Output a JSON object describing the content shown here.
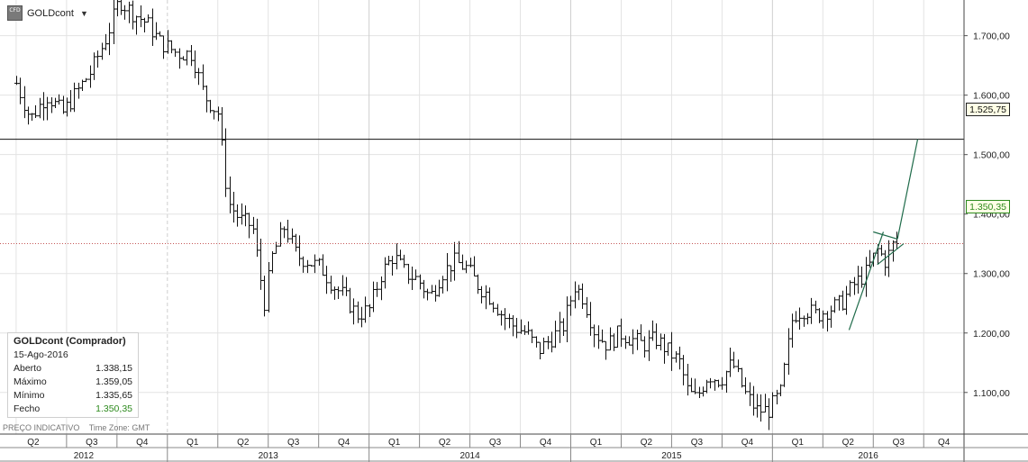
{
  "symbol": {
    "name": "GOLDcont",
    "icon_text": "CFD"
  },
  "info_box": {
    "title": "GOLDcont (Comprador)",
    "date": "15-Ago-2016",
    "open_label": "Aberto",
    "open_value": "1.338,15",
    "high_label": "Máximo",
    "high_value": "1.359,05",
    "low_label": "Mínimo",
    "low_value": "1.335,65",
    "close_label": "Fecho",
    "close_value": "1.350,35"
  },
  "footer": {
    "indicative": "PREÇO INDICATIVO",
    "timezone": "Time Zone: GMT"
  },
  "price_tags": {
    "resistance": "1.525,75",
    "current": "1.350,35"
  },
  "colors": {
    "up_close": "#2e8b1e",
    "bars": "#111111",
    "trendline": "#1f6b4a",
    "current_line": "#b22222"
  },
  "chart_data": {
    "type": "ohlc",
    "instrument": "GOLDcont",
    "ylim": [
      1030,
      1760
    ],
    "y_ticks": [
      1100,
      1200,
      1300,
      1400,
      1500,
      1600,
      1700
    ],
    "y_tick_labels": [
      "1.100,00",
      "1.200,00",
      "1.300,00",
      "1.400,00",
      "1.500,00",
      "1.600,00",
      "1.700,00"
    ],
    "quarters": [
      "Q2",
      "Q3",
      "Q4",
      "Q1",
      "Q2",
      "Q3",
      "Q4",
      "Q1",
      "Q2",
      "Q3",
      "Q4",
      "Q1",
      "Q2",
      "Q3",
      "Q4",
      "Q1",
      "Q2",
      "Q3",
      "Q4"
    ],
    "years": [
      "2012",
      "2013",
      "2014",
      "2015",
      "2016"
    ],
    "current_price": 1350.35,
    "resistance_level": 1525.75,
    "price_path": [
      [
        2012.25,
        1620
      ],
      [
        2012.32,
        1560
      ],
      [
        2012.4,
        1600
      ],
      [
        2012.48,
        1570
      ],
      [
        2012.56,
        1610
      ],
      [
        2012.62,
        1640
      ],
      [
        2012.7,
        1700
      ],
      [
        2012.76,
        1760
      ],
      [
        2012.82,
        1740
      ],
      [
        2012.9,
        1720
      ],
      [
        2012.96,
        1690
      ],
      [
        2013.05,
        1670
      ],
      [
        2013.12,
        1670
      ],
      [
        2013.18,
        1600
      ],
      [
        2013.25,
        1570
      ],
      [
        2013.3,
        1420
      ],
      [
        2013.36,
        1390
      ],
      [
        2013.42,
        1380
      ],
      [
        2013.48,
        1250
      ],
      [
        2013.52,
        1330
      ],
      [
        2013.58,
        1380
      ],
      [
        2013.64,
        1330
      ],
      [
        2013.7,
        1320
      ],
      [
        2013.76,
        1310
      ],
      [
        2013.82,
        1280
      ],
      [
        2013.88,
        1260
      ],
      [
        2013.94,
        1230
      ],
      [
        2014.0,
        1240
      ],
      [
        2014.06,
        1300
      ],
      [
        2014.12,
        1330
      ],
      [
        2014.18,
        1300
      ],
      [
        2014.24,
        1290
      ],
      [
        2014.3,
        1260
      ],
      [
        2014.36,
        1300
      ],
      [
        2014.42,
        1320
      ],
      [
        2014.48,
        1310
      ],
      [
        2014.54,
        1280
      ],
      [
        2014.6,
        1260
      ],
      [
        2014.66,
        1230
      ],
      [
        2014.72,
        1210
      ],
      [
        2014.78,
        1200
      ],
      [
        2014.84,
        1170
      ],
      [
        2014.9,
        1190
      ],
      [
        2014.96,
        1210
      ],
      [
        2015.02,
        1280
      ],
      [
        2015.06,
        1260
      ],
      [
        2015.12,
        1200
      ],
      [
        2015.18,
        1180
      ],
      [
        2015.24,
        1200
      ],
      [
        2015.3,
        1190
      ],
      [
        2015.36,
        1180
      ],
      [
        2015.42,
        1190
      ],
      [
        2015.48,
        1170
      ],
      [
        2015.54,
        1150
      ],
      [
        2015.58,
        1100
      ],
      [
        2015.62,
        1090
      ],
      [
        2015.68,
        1130
      ],
      [
        2015.74,
        1120
      ],
      [
        2015.8,
        1150
      ],
      [
        2015.86,
        1100
      ],
      [
        2015.92,
        1070
      ],
      [
        2015.98,
        1070
      ],
      [
        2016.04,
        1100
      ],
      [
        2016.1,
        1230
      ],
      [
        2016.16,
        1240
      ],
      [
        2016.22,
        1230
      ],
      [
        2016.28,
        1240
      ],
      [
        2016.34,
        1250
      ],
      [
        2016.4,
        1280
      ],
      [
        2016.46,
        1300
      ],
      [
        2016.52,
        1340
      ],
      [
        2016.56,
        1320
      ],
      [
        2016.6,
        1350
      ],
      [
        2016.62,
        1350.35
      ]
    ],
    "trendlines": [
      {
        "from": [
          2016.38,
          1205
        ],
        "to": [
          2016.55,
          1370
        ]
      },
      {
        "from": [
          2016.5,
          1370
        ],
        "to": [
          2016.62,
          1358
        ]
      },
      {
        "from": [
          2016.52,
          1315
        ],
        "to": [
          2016.65,
          1350
        ]
      },
      {
        "from": [
          2016.62,
          1358
        ],
        "to": [
          2016.72,
          1525.75
        ]
      }
    ]
  }
}
